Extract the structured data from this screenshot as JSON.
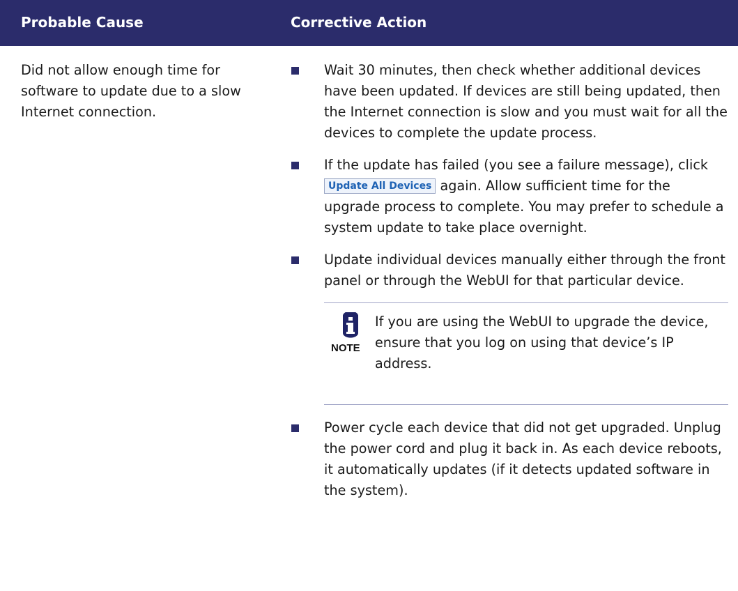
{
  "header": {
    "col1": "Probable Cause",
    "col2": "Corrective Action"
  },
  "cause": "Did not allow enough time for software to update due to a slow Internet connection.",
  "actions": [
    {
      "text": "Wait 30 minutes, then check whether additional devices have been updated. If devices are still being updated, then the Internet connection is slow and you must wait for all the devices to complete the update process."
    },
    {
      "before": "If the update has failed (you see a failure message), click ",
      "button_label": "Update All Devices",
      "after": " again. Allow sufficient time for the upgrade process to complete. You may prefer to schedule a system update to take place overnight."
    },
    {
      "text": "Update individual devices manually either through the front panel or through the WebUI for that particular device."
    },
    {
      "text": "Power cycle each device that did not get upgraded. Unplug the power cord and plug it back in. As each device reboots, it automatically updates (if it detects updated software in the system)."
    }
  ],
  "note": {
    "label": "NOTE",
    "icon": "info-icon",
    "text": "If you are using the WebUI to upgrade the device, ensure that you log on using that device’s IP address."
  },
  "colors": {
    "header_bg": "#2b2c6b",
    "bullet": "#2b2c6b",
    "button_text": "#1e62b4"
  }
}
